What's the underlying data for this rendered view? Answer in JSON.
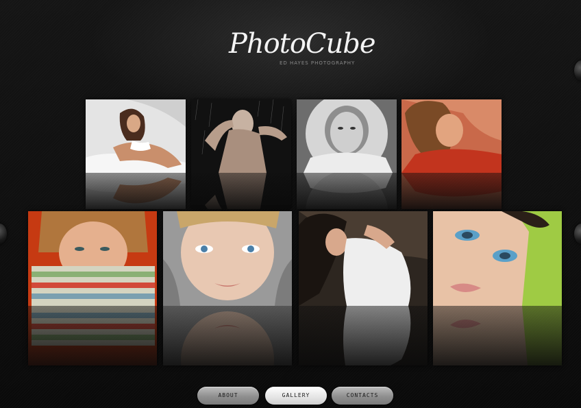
{
  "logo": {
    "title": "PhotoCube",
    "subtitle": "ED HAYES PHOTOGRAPHY"
  },
  "gallery": {
    "photos": [
      {
        "name": "portrait-white-bed",
        "accent": "#d8d8d8"
      },
      {
        "name": "portrait-rain",
        "accent": "#1a1a1a"
      },
      {
        "name": "portrait-fur-hood-bw",
        "accent": "#9a9a9a"
      },
      {
        "name": "portrait-curly-red",
        "accent": "#b8452a"
      },
      {
        "name": "portrait-striped-scarf",
        "accent": "#d86a2a"
      },
      {
        "name": "portrait-blue-eyes-knit",
        "accent": "#d9b8a2"
      },
      {
        "name": "portrait-white-top-dark-hair",
        "accent": "#3a2a22"
      },
      {
        "name": "portrait-green-makeup",
        "accent": "#9fcb44"
      }
    ]
  },
  "nav": {
    "about": "ABOUT",
    "gallery": "GALLERY",
    "contacts": "CONTACTS",
    "active": "gallery"
  }
}
